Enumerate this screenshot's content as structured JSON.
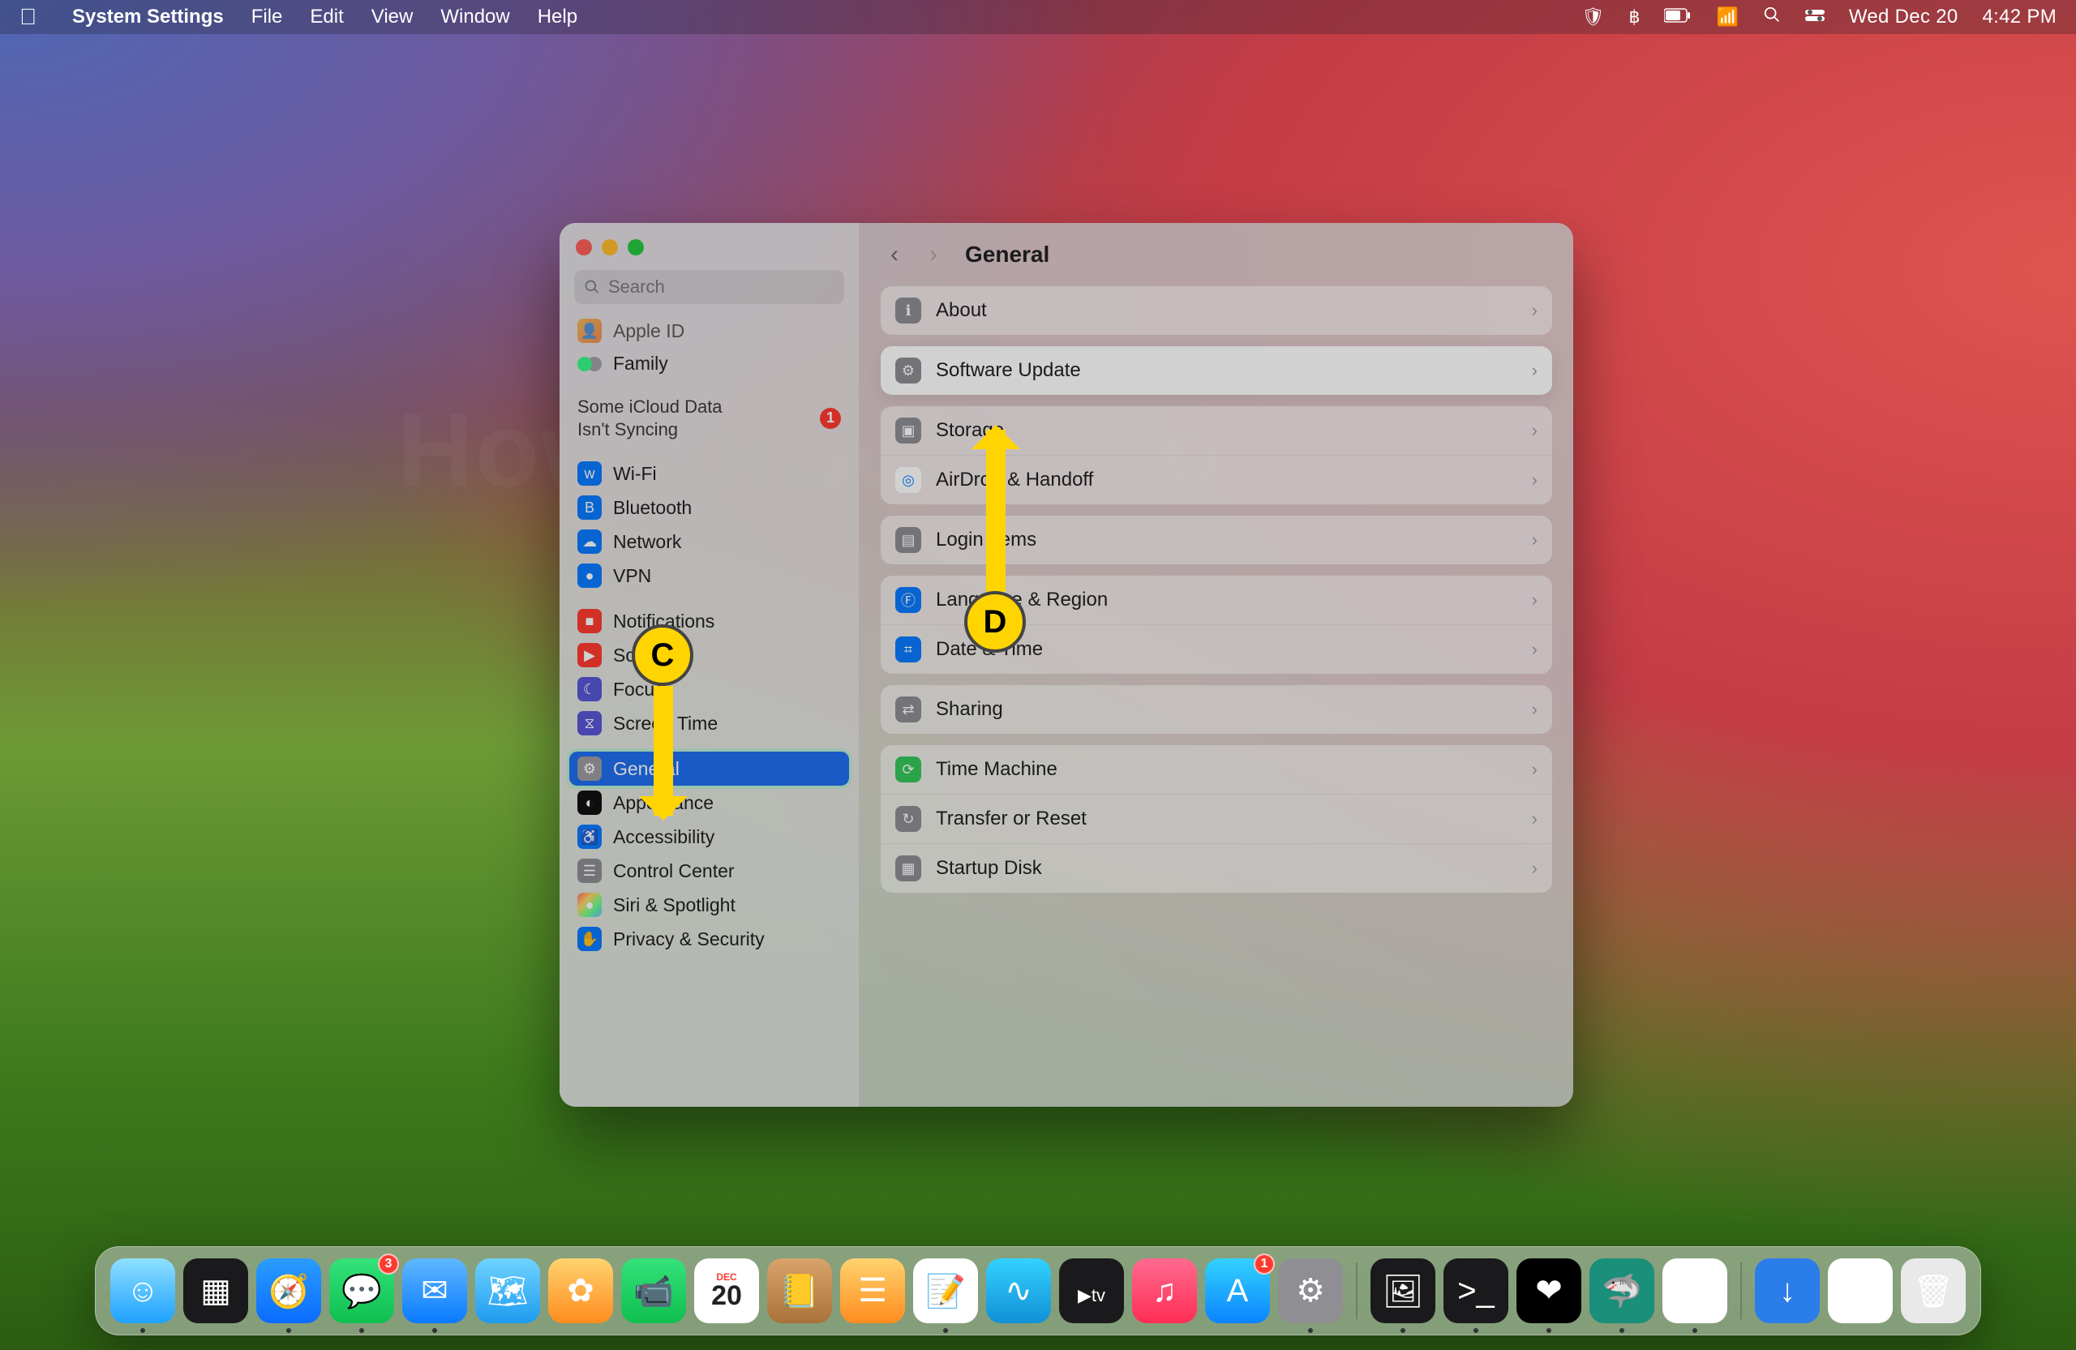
{
  "menubar": {
    "app": "System Settings",
    "items": [
      "File",
      "Edit",
      "View",
      "Window",
      "Help"
    ],
    "date": "Wed Dec 20",
    "time": "4:42 PM"
  },
  "window": {
    "search_placeholder": "Search",
    "title": "General",
    "sidebar_top": [
      {
        "label": "Apple ID"
      },
      {
        "label": "Family"
      }
    ],
    "warning": {
      "line1": "Some iCloud Data",
      "line2": "Isn't Syncing",
      "badge": "1"
    },
    "sidebar_net": [
      {
        "label": "Wi-Fi",
        "cls": "i-blue",
        "glyph": "ᴡ"
      },
      {
        "label": "Bluetooth",
        "cls": "i-blue",
        "glyph": "B"
      },
      {
        "label": "Network",
        "cls": "i-blue",
        "glyph": "☁"
      },
      {
        "label": "VPN",
        "cls": "i-blue",
        "glyph": "●"
      }
    ],
    "sidebar_mid": [
      {
        "label": "Notifications",
        "cls": "i-red",
        "glyph": "■"
      },
      {
        "label": "Sound",
        "cls": "i-red",
        "glyph": "▶"
      },
      {
        "label": "Focus",
        "cls": "i-purple",
        "glyph": "☾"
      },
      {
        "label": "Screen Time",
        "cls": "i-purple",
        "glyph": "⧖"
      }
    ],
    "sidebar_sys": [
      {
        "label": "General",
        "cls": "i-grey",
        "glyph": "⚙",
        "sel": true
      },
      {
        "label": "Appearance",
        "cls": "i-black",
        "glyph": "◐"
      },
      {
        "label": "Accessibility",
        "cls": "i-blue",
        "glyph": "♿"
      },
      {
        "label": "Control Center",
        "cls": "i-grey",
        "glyph": "☰"
      },
      {
        "label": "Siri & Spotlight",
        "cls": "i-grad",
        "glyph": "●"
      },
      {
        "label": "Privacy & Security",
        "cls": "i-blue",
        "glyph": "✋"
      }
    ],
    "groups": [
      [
        {
          "label": "About",
          "cls": "i-grey",
          "glyph": "ℹ"
        }
      ],
      [
        {
          "label": "Software Update",
          "cls": "i-grey",
          "glyph": "⚙",
          "hi": true
        }
      ],
      [
        {
          "label": "Storage",
          "cls": "i-grey",
          "glyph": "▣"
        },
        {
          "label": "AirDrop & Handoff",
          "cls": "i-teal",
          "glyph": "◎",
          "white": true
        }
      ],
      [
        {
          "label": "Login Items",
          "cls": "i-grey",
          "glyph": "▤"
        }
      ],
      [
        {
          "label": "Language & Region",
          "cls": "i-blue",
          "glyph": "Ⓕ"
        },
        {
          "label": "Date & Time",
          "cls": "i-blue",
          "glyph": "⌗"
        }
      ],
      [
        {
          "label": "Sharing",
          "cls": "i-grey",
          "glyph": "⇄"
        }
      ],
      [
        {
          "label": "Time Machine",
          "cls": "i-green",
          "glyph": "⟳"
        },
        {
          "label": "Transfer or Reset",
          "cls": "i-grey",
          "glyph": "↻"
        },
        {
          "label": "Startup Disk",
          "cls": "i-grey",
          "glyph": "▦"
        }
      ]
    ]
  },
  "annotations": {
    "c": "C",
    "d": "D"
  },
  "dock": {
    "cal_month": "DEC",
    "cal_day": "20",
    "apps": [
      {
        "n": "finder",
        "badge": null,
        "dot": true
      },
      {
        "n": "launchpad"
      },
      {
        "n": "safari",
        "dot": true
      },
      {
        "n": "messages",
        "badge": "3",
        "dot": true
      },
      {
        "n": "mail",
        "dot": true
      },
      {
        "n": "maps"
      },
      {
        "n": "photos"
      },
      {
        "n": "facetime"
      },
      {
        "n": "calendar"
      },
      {
        "n": "contacts"
      },
      {
        "n": "reminders"
      },
      {
        "n": "notes",
        "dot": true
      },
      {
        "n": "freeform"
      },
      {
        "n": "tv"
      },
      {
        "n": "music"
      },
      {
        "n": "appstore",
        "badge": "1"
      },
      {
        "n": "settings",
        "dot": true
      }
    ],
    "right": [
      {
        "n": "preview",
        "dot": true
      },
      {
        "n": "terminal",
        "dot": true
      },
      {
        "n": "activity-monitor",
        "dot": true
      },
      {
        "n": "surfshark",
        "dot": true
      },
      {
        "n": "chrome",
        "dot": true
      }
    ],
    "far": [
      {
        "n": "downloads"
      },
      {
        "n": "stack"
      },
      {
        "n": "trash"
      }
    ]
  }
}
